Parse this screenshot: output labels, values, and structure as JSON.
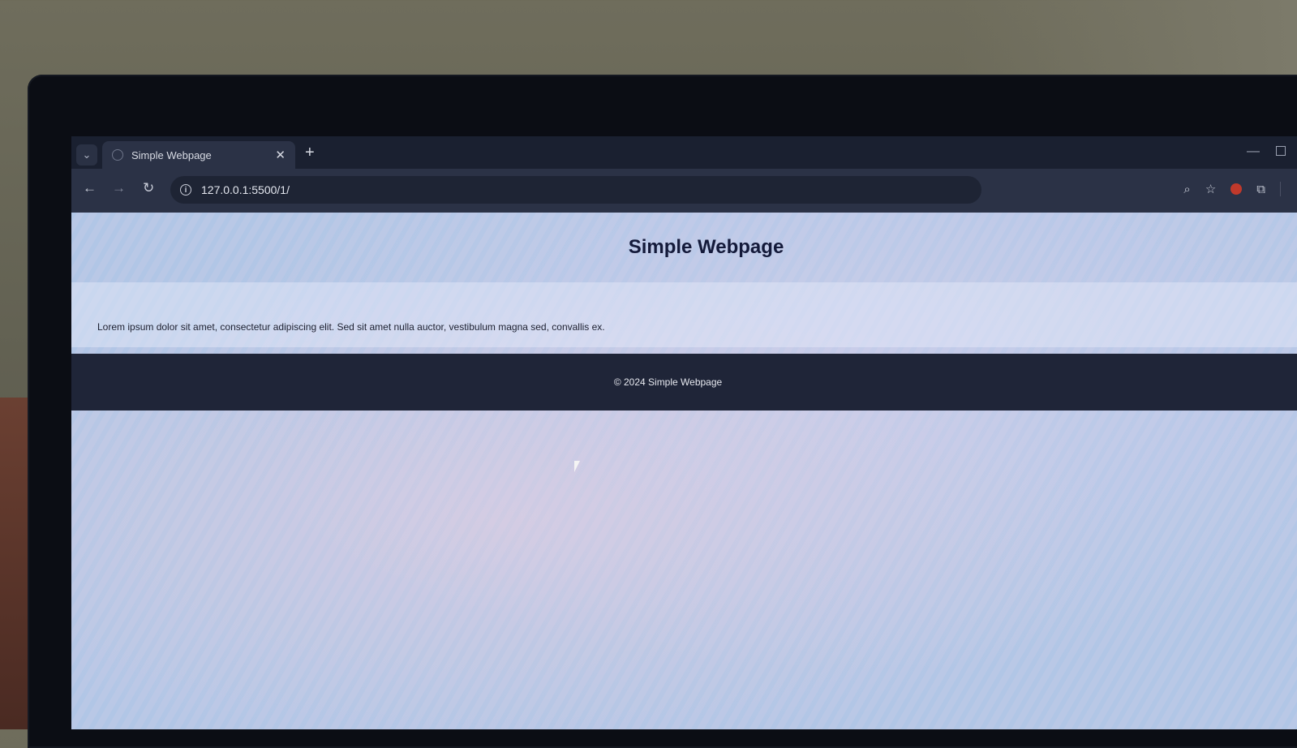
{
  "browser": {
    "tab_title": "Simple Webpage",
    "tab_close": "✕",
    "new_tab": "+",
    "url": "127.0.0.1:5500/1/"
  },
  "page": {
    "title": "Simple Webpage",
    "body_text": "Lorem ipsum dolor sit amet, consectetur adipiscing elit. Sed sit amet nulla auctor, vestibulum magna sed, convallis ex.",
    "footer_text": "© 2024 Simple Webpage"
  },
  "icons": [
    "chevron-down-icon",
    "globe-icon",
    "close-icon",
    "plus-icon",
    "back-arrow-icon",
    "forward-arrow-icon",
    "reload-icon",
    "info-icon",
    "zoom-icon",
    "star-icon",
    "extension-icon",
    "puzzle-icon",
    "minimize-icon",
    "maximize-icon"
  ],
  "colors": {
    "footer_bg": "#1f2538",
    "title_color": "#141a3a",
    "chrome_bg": "#2b3246"
  }
}
